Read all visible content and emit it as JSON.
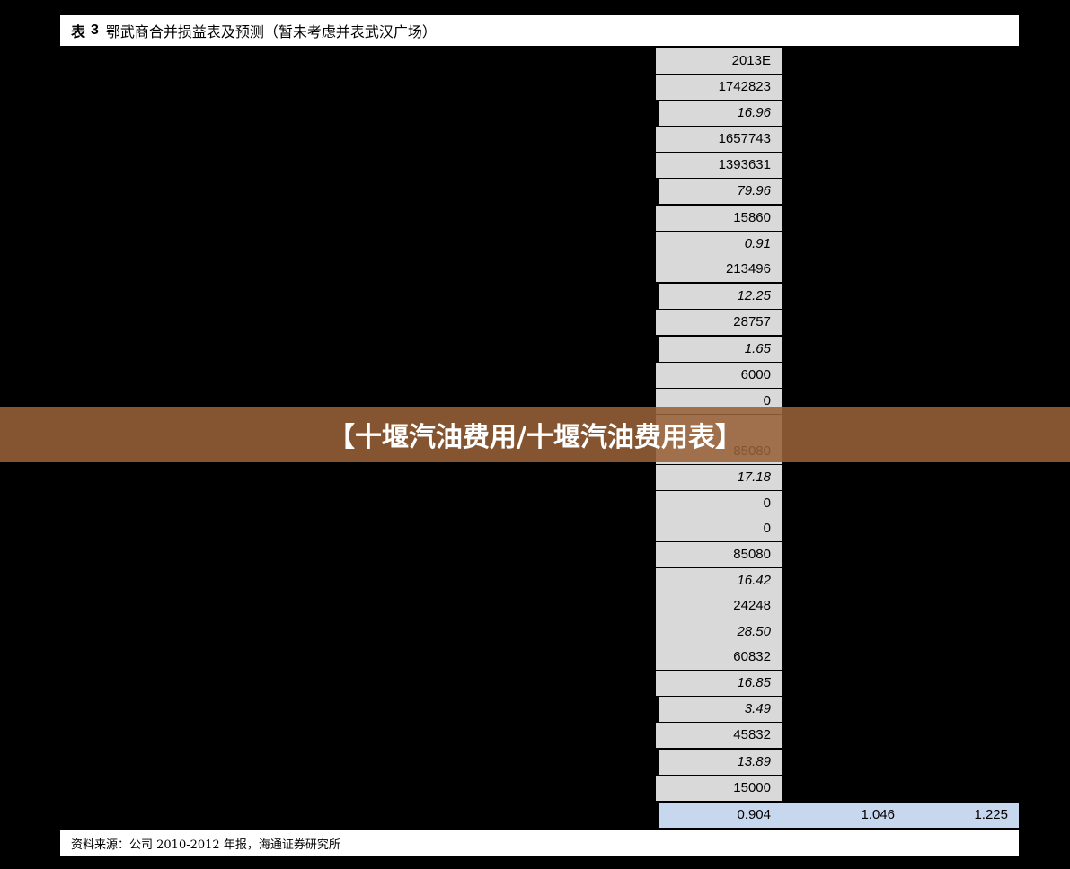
{
  "header": {
    "prefix": "表",
    "number": "3",
    "title": "鄂武商合并损益表及预测（暂未考虑并表武汉广场）"
  },
  "column": {
    "cells": [
      {
        "value": "2013E",
        "italic": false,
        "indent": false
      },
      {
        "value": "1742823",
        "italic": false,
        "indent": false
      },
      {
        "value": "16.96",
        "italic": true,
        "indent": true
      },
      {
        "value": "1657743",
        "italic": false,
        "indent": false
      },
      {
        "value": "1393631",
        "italic": false,
        "indent": false
      },
      {
        "value": "79.96",
        "italic": true,
        "indent": true
      },
      {
        "value": "15860",
        "italic": false,
        "indent": false
      },
      {
        "value": "0.91",
        "italic": true,
        "indent": false
      },
      {
        "value": "213496",
        "italic": false,
        "indent": false
      },
      {
        "value": "12.25",
        "italic": true,
        "indent": true
      },
      {
        "value": "28757",
        "italic": false,
        "indent": false
      },
      {
        "value": "1.65",
        "italic": true,
        "indent": true
      },
      {
        "value": "6000",
        "italic": false,
        "indent": false
      },
      {
        "value": "0",
        "italic": false,
        "indent": false
      },
      {
        "value": "",
        "italic": false,
        "indent": false
      },
      {
        "value": "85080",
        "italic": false,
        "indent": false
      },
      {
        "value": "17.18",
        "italic": true,
        "indent": false
      },
      {
        "value": "0",
        "italic": false,
        "indent": false
      },
      {
        "value": "0",
        "italic": false,
        "indent": false
      },
      {
        "value": "85080",
        "italic": false,
        "indent": false
      },
      {
        "value": "16.42",
        "italic": true,
        "indent": false
      },
      {
        "value": "24248",
        "italic": false,
        "indent": false
      },
      {
        "value": "28.50",
        "italic": true,
        "indent": false
      },
      {
        "value": "60832",
        "italic": false,
        "indent": false
      },
      {
        "value": "16.85",
        "italic": true,
        "indent": false
      },
      {
        "value": "3.49",
        "italic": true,
        "indent": true
      },
      {
        "value": "45832",
        "italic": false,
        "indent": false
      },
      {
        "value": "13.89",
        "italic": true,
        "indent": true
      },
      {
        "value": "15000",
        "italic": false,
        "indent": false
      }
    ],
    "last_row": [
      "0.904",
      "1.046",
      "1.225"
    ]
  },
  "footer": {
    "source": "资料来源：公司 2010-2012 年报，海通证券研究所"
  },
  "overlay": {
    "text": "【十堰汽油费用/十堰汽油费用表】"
  },
  "colors": {
    "background": "#000000",
    "cell": "#d9d9d9",
    "highlight_row": "#c7d7ee",
    "overlay": "#966137"
  }
}
